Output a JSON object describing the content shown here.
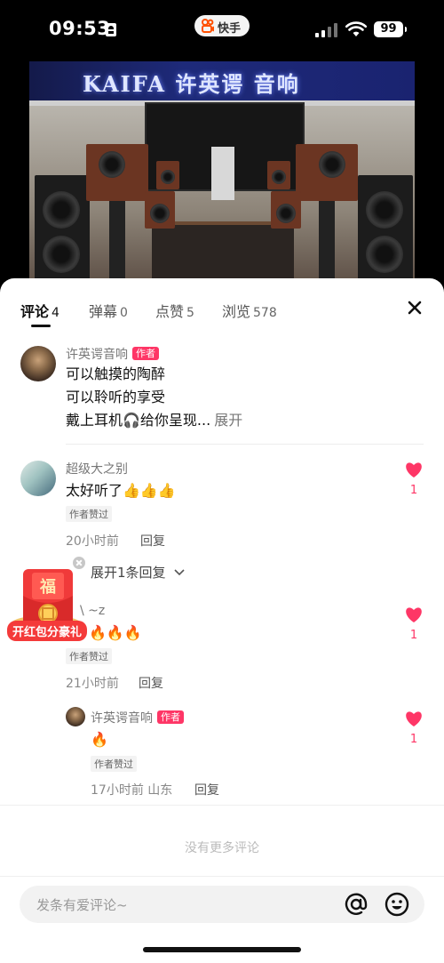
{
  "status_bar": {
    "time": "09:53",
    "app_name": "快手",
    "battery": "99"
  },
  "video": {
    "sign_text": "KAIFA 许英谔 音响"
  },
  "tabs": [
    {
      "label": "评论",
      "count": "4",
      "active": true
    },
    {
      "label": "弹幕",
      "count": "0",
      "active": false
    },
    {
      "label": "点赞",
      "count": "5",
      "active": false
    },
    {
      "label": "浏览",
      "count": "578",
      "active": false
    }
  ],
  "pinned_comment": {
    "username": "许英谔音响",
    "author_badge": "作者",
    "lines": [
      "可以触摸的陶醉",
      "可以聆听的享受",
      "戴上耳机🎧给你呈现..."
    ],
    "expand_label": "展开"
  },
  "comments": [
    {
      "username": "超级大之别",
      "text": "太好听了👍👍👍",
      "liked_badge": "作者赞过",
      "time": "20小时前",
      "reply_label": "回复",
      "like_count": "1"
    },
    {
      "username": "\\ ~z",
      "text": "🔥🔥🔥",
      "liked_badge": "作者赞过",
      "time": "21小时前",
      "reply_label": "回复",
      "like_count": "1"
    }
  ],
  "expand_replies": "展开1条回复",
  "reply": {
    "username": "许英谔音响",
    "author_badge": "作者",
    "text": "🔥",
    "liked_badge": "作者赞过",
    "time": "17小时前 山东",
    "reply_label": "回复",
    "like_count": "1"
  },
  "no_more": "没有更多评论",
  "input": {
    "placeholder": "发条有爱评论~"
  },
  "red_envelope": {
    "char": "福",
    "label": "开红包分豪礼"
  },
  "colors": {
    "accent": "#fe3666",
    "red_envelope": "#f43a3a"
  }
}
